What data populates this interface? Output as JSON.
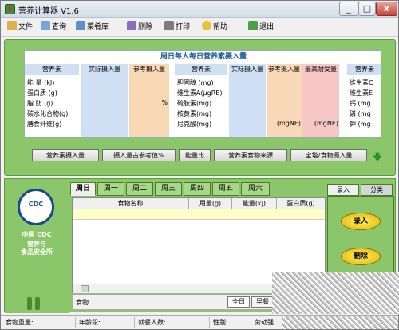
{
  "window": {
    "title": "营养计算器 V1.6",
    "min": "_",
    "max": "□",
    "close": "x"
  },
  "toolbar": {
    "file": "文件",
    "query": "查询",
    "menu": "菜肴库",
    "delete": "删除",
    "print": "打印",
    "help": "帮助",
    "exit": "退出"
  },
  "nutrient_table": {
    "title": "周日每人每日营养素摄入量",
    "col1": {
      "h_nutrient": "营养素",
      "h_actual": "实际摄入量",
      "h_ref": "参考摄入量",
      "rows": [
        "能 量 (kJ)",
        "蛋白质 (g)",
        "脂 肪 (g)",
        "碳水化合物(g)",
        "膳食纤维(g)"
      ],
      "pct": "%"
    },
    "col2": {
      "h_nutrient": "营养素",
      "h_actual": "实际摄入量",
      "h_ref": "参考摄入量",
      "h_max": "最高耐受量",
      "rows": [
        "胆固醇 (mg)",
        "维生素A(μgRE)",
        "硫胺素(mg)",
        "核黄素(mg)",
        "尼克酸(mg)"
      ],
      "ne1": "(mgNE)",
      "ne2": "(mgNE)"
    },
    "col3": {
      "h_nutrient": "营养素",
      "rows": [
        "维生素C",
        "维生素E",
        "钙 (mg",
        "磷 (mg",
        "钾 (mg"
      ]
    }
  },
  "green_tabs": [
    "营养素摄入量",
    "摄入量占参考值%",
    "能量比",
    "营养素食物来源",
    "宝塔/食物摄入量"
  ],
  "logo": {
    "cdc": "CDC",
    "line1": "中国 CDC",
    "line2": "营养与",
    "line3": "食品安全所"
  },
  "day_tabs": [
    "周日",
    "周一",
    "周二",
    "周三",
    "周四",
    "周五",
    "周六"
  ],
  "food_grid": {
    "headers": [
      "食物名称",
      "用量(g)",
      "能量(kj)",
      "蛋白质(g)"
    ]
  },
  "food_bar": {
    "label": "食物",
    "all_day": "全日",
    "breakfast": "早餐"
  },
  "side_tabs": [
    "录入",
    "分类"
  ],
  "side_buttons": {
    "enter": "录入",
    "delete": "删除"
  },
  "status": {
    "food_weight": "食物重量:",
    "age": "年龄段:",
    "diners": "就餐人数:",
    "gender": "性别:",
    "labor": "劳动强"
  }
}
